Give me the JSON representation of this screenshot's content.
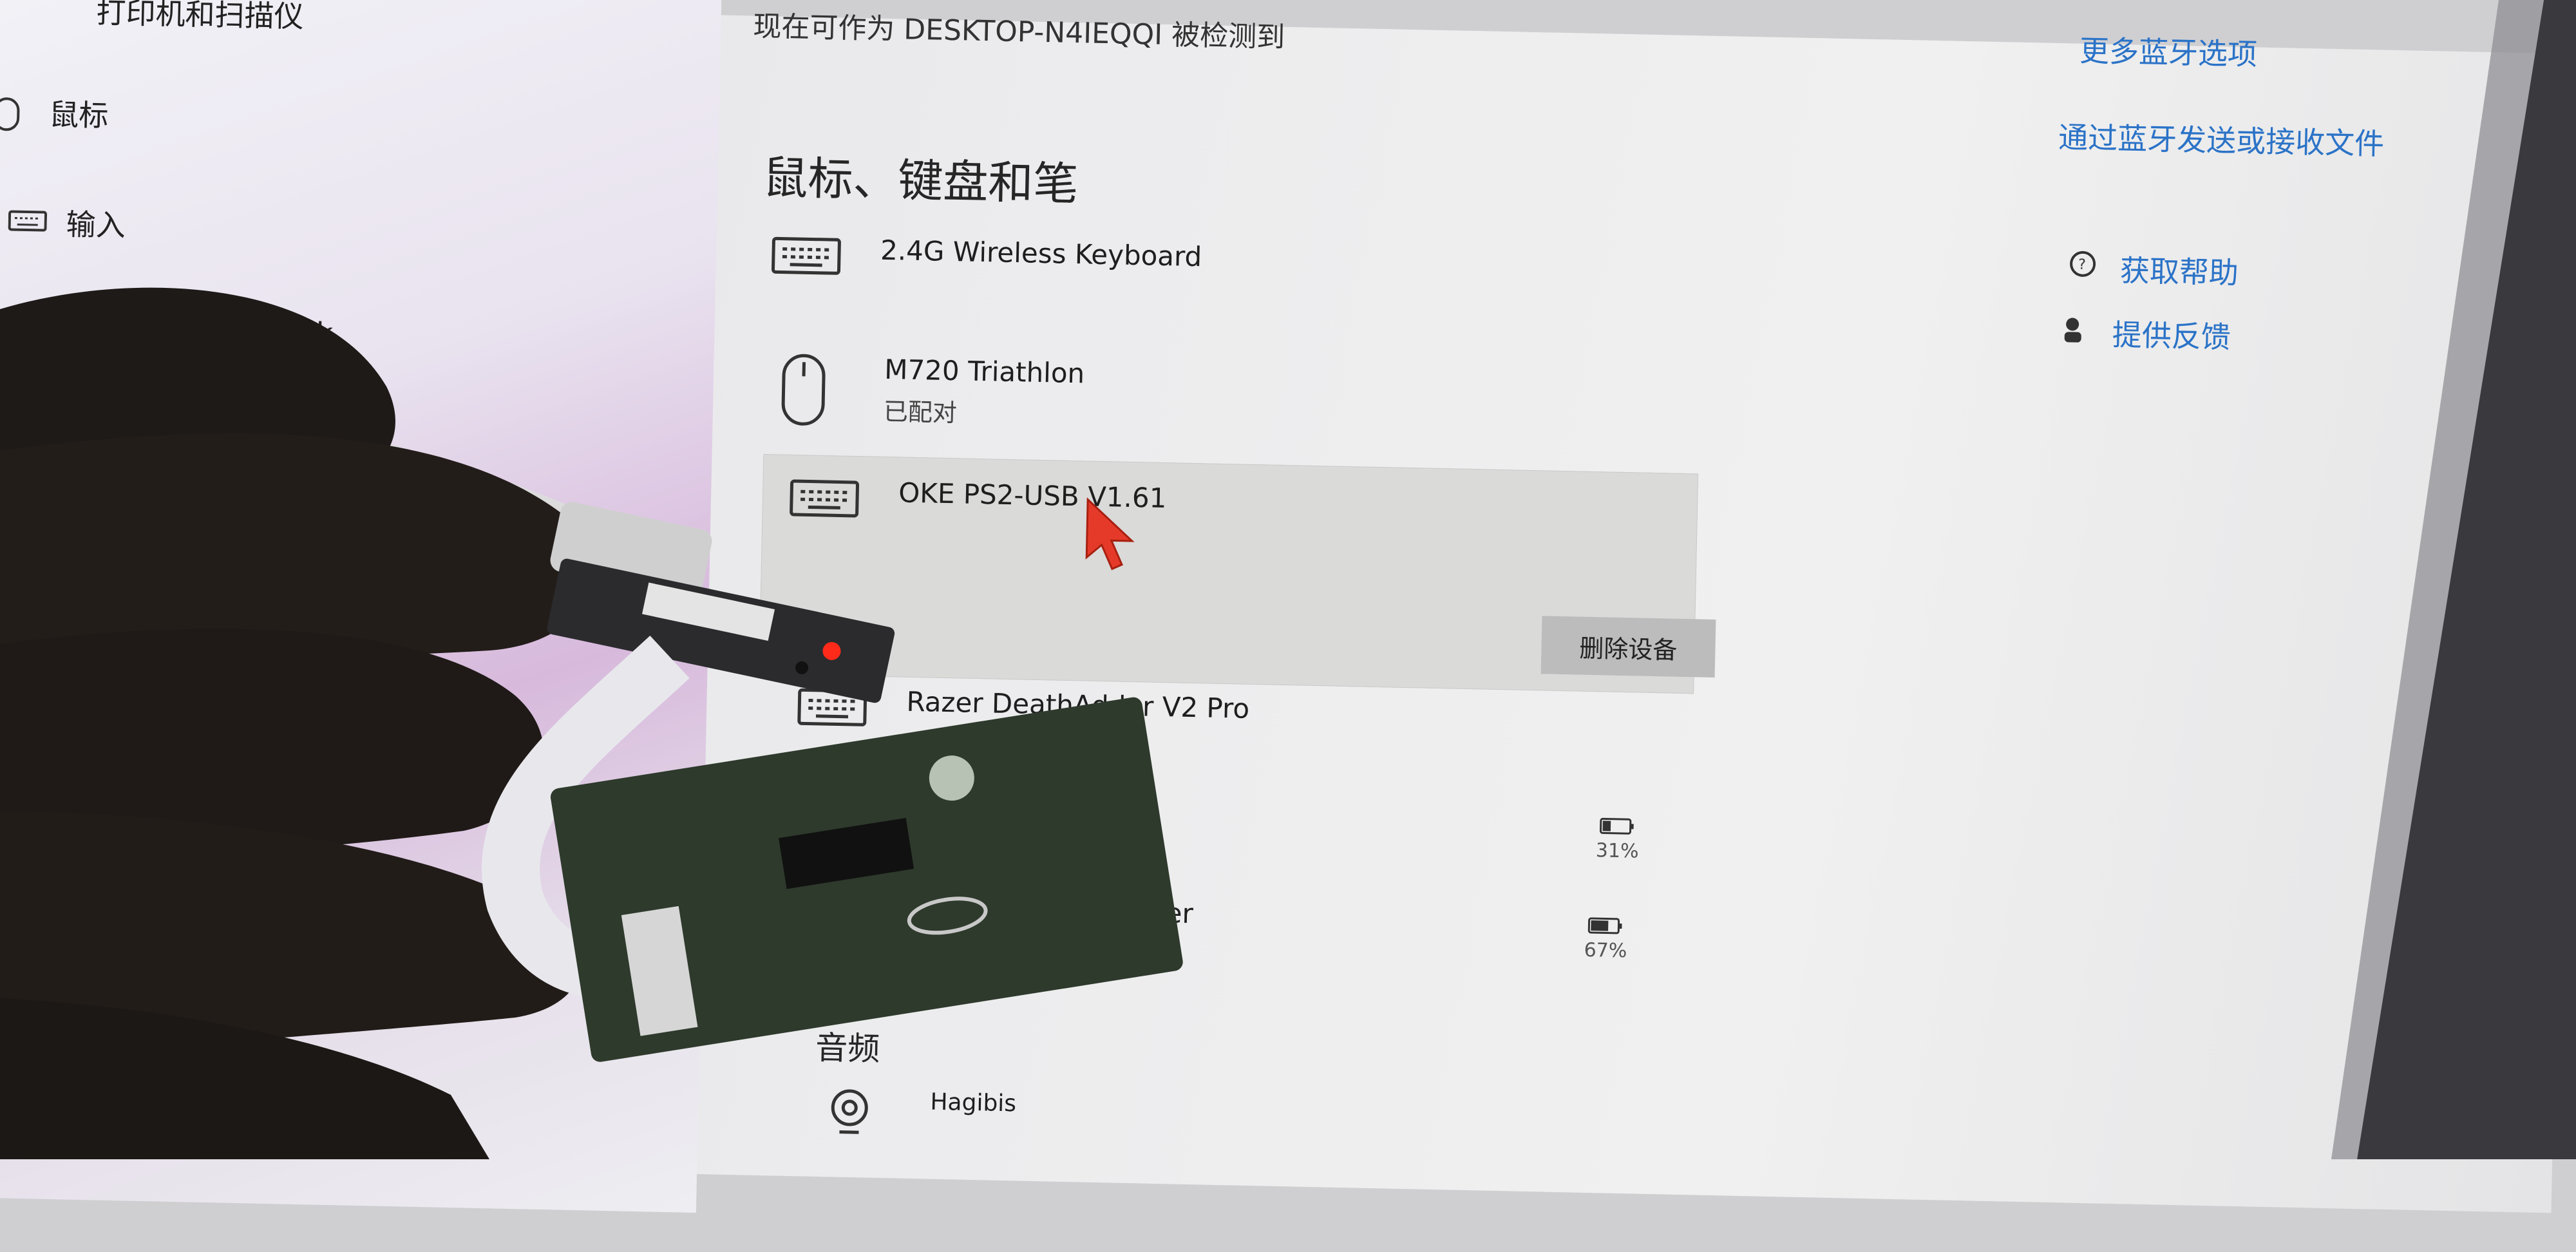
{
  "sidebar": {
    "items": [
      {
        "label": "打印机和扫描仪",
        "icon": "printer-icon"
      },
      {
        "label": "鼠标",
        "icon": "mouse-icon"
      },
      {
        "label": "输入",
        "icon": "keyboard-icon"
      },
      {
        "label": "s Ink",
        "icon": "pen-icon"
      }
    ]
  },
  "header": {
    "discoverable_text": "现在可作为 DESKTOP-N4IEQQI 被检测到",
    "more_options_link": "更多蓝牙选项",
    "send_receive_link": "通过蓝牙发送或接收文件"
  },
  "help": {
    "get_help": "获取帮助",
    "feedback": "提供反馈"
  },
  "section_mouse": {
    "title": "鼠标、键盘和笔",
    "devices": [
      {
        "name": "2.4G Wireless Keyboard",
        "status": "",
        "icon": "keyboard-icon"
      },
      {
        "name": "M720 Triathlon",
        "status": "已配对",
        "icon": "mouse-icon"
      },
      {
        "name": "OKE PS2-USB V1.61",
        "status": "",
        "icon": "keyboard-icon",
        "selected": true,
        "action": "删除设备"
      },
      {
        "name": "Razer DeathAdder V2 Pro",
        "status": "",
        "icon": "keyboard-icon"
      }
    ]
  },
  "partial_device": {
    "name_fragment": "oller"
  },
  "batteries": [
    {
      "percent": "31%",
      "level": 0.31
    },
    {
      "percent": "67%",
      "level": 0.67
    }
  ],
  "section_audio": {
    "title": "音频",
    "devices": [
      {
        "name": "Hagibis",
        "icon": "webcam-icon"
      }
    ]
  },
  "colors": {
    "link": "#2b73c7",
    "selected_bg": "#dadad9",
    "button_bg": "#bcbcbc",
    "cursor": "#e53a2a",
    "led": "#ff2a1a"
  }
}
